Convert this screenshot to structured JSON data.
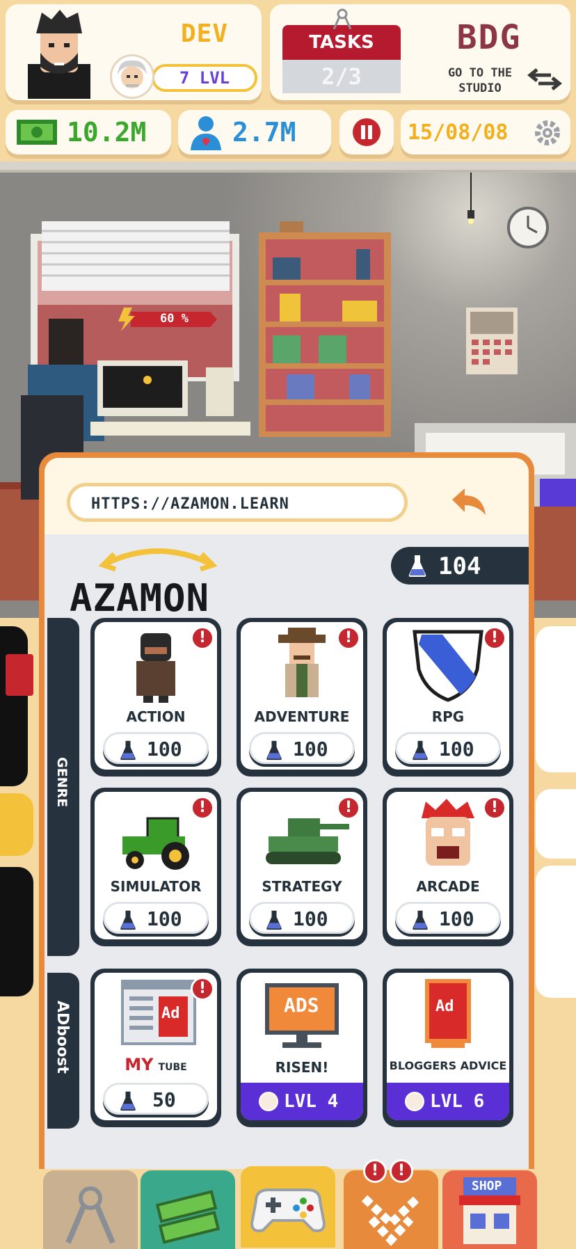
{
  "header": {
    "developer": {
      "name": "DEV",
      "level": "7 LVL"
    },
    "tasks": {
      "label": "TASKS",
      "progress": "2/3"
    },
    "studio": {
      "name": "BDG",
      "link_text": "GO TO THE STUDIO"
    }
  },
  "stats": {
    "money": "10.2M",
    "fans": "2.7M",
    "date": "15/08/08"
  },
  "popup": {
    "url": "HTTPS://AZAMON.LEARN",
    "store_name": "AZAMON",
    "points": "104",
    "sections": {
      "genre": "GENRE",
      "adboost": "ADboost"
    },
    "genres": [
      {
        "label": "ACTION",
        "price": "100",
        "alert": "!"
      },
      {
        "label": "ADVENTURE",
        "price": "100",
        "alert": "!"
      },
      {
        "label": "RPG",
        "price": "100",
        "alert": "!"
      },
      {
        "label": "SIMULATOR",
        "price": "100",
        "alert": "!"
      },
      {
        "label": "STRATEGY",
        "price": "100",
        "alert": "!"
      },
      {
        "label": "ARCADE",
        "price": "100",
        "alert": "!"
      }
    ],
    "adboosts": [
      {
        "label_big": "MY",
        "label_small": "TUBE",
        "price": "50",
        "alert": "!",
        "art_text": "Ad"
      },
      {
        "label": "RISEN!",
        "level": "LVL 4",
        "art_text": "ADS"
      },
      {
        "label": "BLOGGERS ADVICE",
        "level": "LVL 6",
        "art_text": "Ad"
      }
    ]
  },
  "room": {
    "progress_label": "60 %"
  },
  "nav": {
    "shop_label": "SHOP",
    "alerts": [
      "!",
      "!"
    ]
  },
  "colors": {
    "background": "#f6d9a0",
    "accent_yellow": "#f2b01e",
    "money_green": "#3aa82c",
    "fans_blue": "#2a8fd6",
    "tasks_red": "#b61a2f",
    "studio_maroon": "#8c3546",
    "dark_navy": "#26333f",
    "level_purple": "#5a2fd6",
    "popup_orange": "#e78a3c"
  },
  "icons": [
    "cash-icon",
    "fan-icon",
    "pause-icon",
    "gear-icon",
    "compass-icon",
    "swap-icon",
    "flask-icon",
    "back-arrow-icon",
    "alert-icon",
    "shop-icon",
    "gamepad-icon",
    "chevrons-icon"
  ]
}
